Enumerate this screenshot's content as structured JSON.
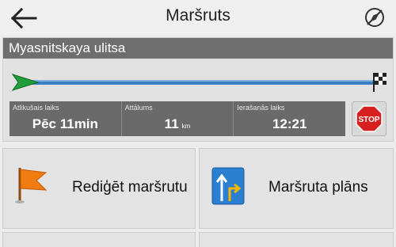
{
  "header": {
    "title": "Maršruts"
  },
  "route": {
    "street": "Myasnitskaya ulitsa",
    "progress_fraction": 0.0,
    "info": {
      "remaining_time": {
        "label": "Atlikušais laiks",
        "value": "Pēc 11min"
      },
      "distance": {
        "label": "Attālums",
        "value": "11",
        "unit": "km"
      },
      "arrival": {
        "label": "Ierašanās laiks",
        "value": "12:21"
      }
    },
    "stop_text": "STOP"
  },
  "buttons": [
    {
      "label": "Rediģēt maršrutu",
      "icon": "orange-flag-icon"
    },
    {
      "label": "Maršruta plāns",
      "icon": "route-plan-icon"
    }
  ],
  "colors": {
    "route_line": "#3b7ec0",
    "start_arrow": "#1f9e3a",
    "stop_sign": "#d62020",
    "flag": "#f07c12",
    "plan_icon": "#2a7fd0"
  }
}
